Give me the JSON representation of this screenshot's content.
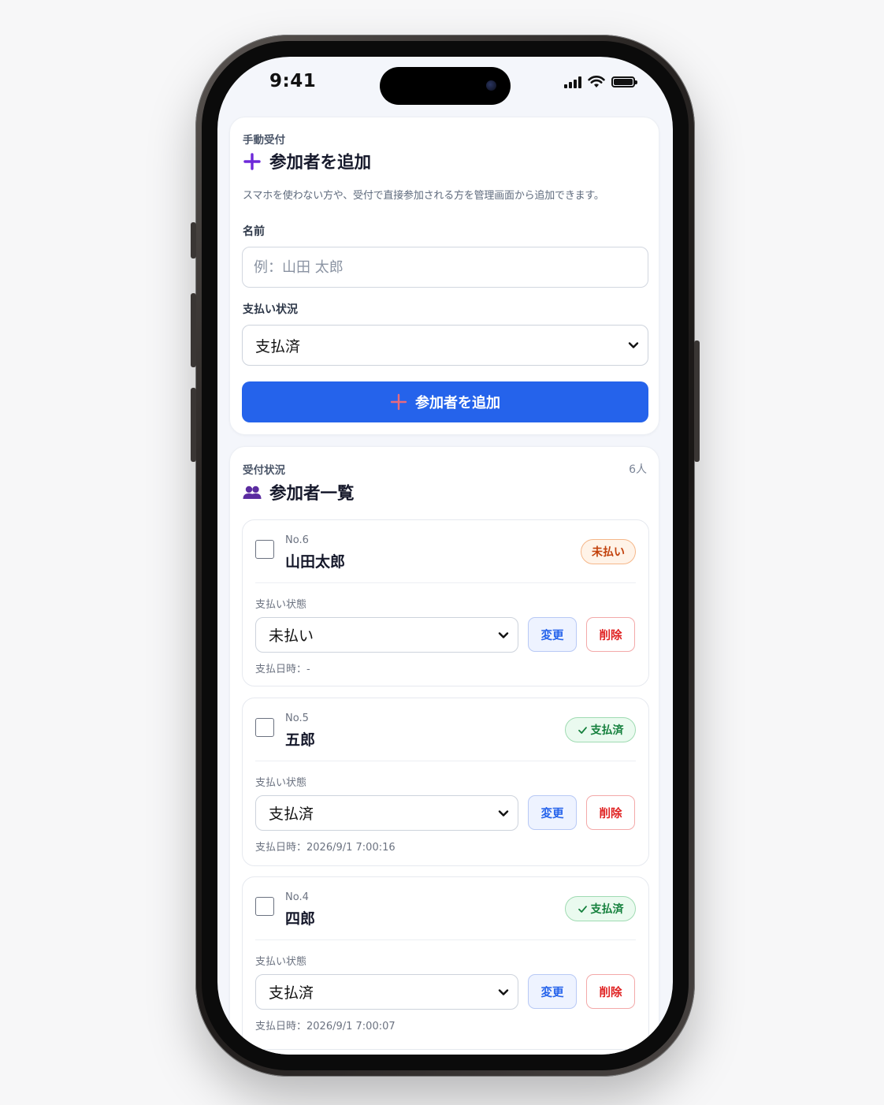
{
  "status_bar": {
    "time": "9:41"
  },
  "add_card": {
    "eyebrow": "手動受付",
    "title": "参加者を追加",
    "description": "スマホを使わない方や、受付で直接参加される方を管理画面から追加できます。",
    "name_label": "名前",
    "name_placeholder": "例：山田 太郎",
    "name_value": "",
    "payment_label": "支払い状況",
    "payment_value": "支払済",
    "submit_label": "参加者を追加"
  },
  "list_card": {
    "eyebrow": "受付状況",
    "title": "参加者一覧",
    "count": "6人",
    "entries": [
      {
        "no": "No.6",
        "name": "山田太郎",
        "badge": "未払い",
        "status_label": "支払い状態",
        "status_value": "未払い",
        "change_label": "変更",
        "delete_label": "削除",
        "paid_at": "支払日時：-"
      },
      {
        "no": "No.5",
        "name": "五郎",
        "badge": "支払済",
        "status_label": "支払い状態",
        "status_value": "支払済",
        "change_label": "変更",
        "delete_label": "削除",
        "paid_at": "支払日時：2026/9/1  7:00:16"
      },
      {
        "no": "No.4",
        "name": "四郎",
        "badge": "支払済",
        "status_label": "支払い状態",
        "status_value": "支払済",
        "change_label": "変更",
        "delete_label": "削除",
        "paid_at": "支払日時：2026/9/1  7:00:07"
      }
    ]
  },
  "colors": {
    "primary": "#2563eb",
    "accent_purple": "#6d28d9",
    "unpaid": "#c2410c",
    "paid": "#15803d",
    "delete": "#e02424"
  }
}
